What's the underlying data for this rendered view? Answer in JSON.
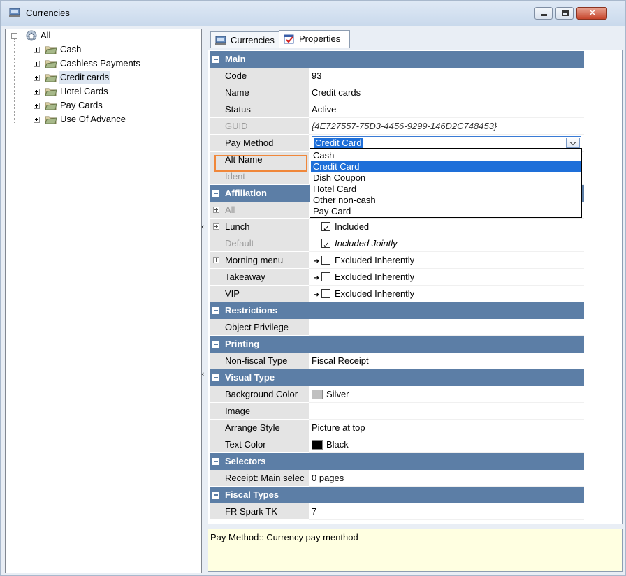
{
  "window": {
    "title": "Currencies"
  },
  "tree": {
    "root": "All",
    "items": [
      {
        "label": "Cash"
      },
      {
        "label": "Cashless Payments"
      },
      {
        "label": "Credit cards",
        "selected": true
      },
      {
        "label": "Hotel Cards"
      },
      {
        "label": "Pay Cards"
      },
      {
        "label": "Use Of Advance"
      }
    ]
  },
  "tabs": [
    {
      "label": "Currencies",
      "active": false
    },
    {
      "label": "Properties",
      "active": true
    }
  ],
  "properties": {
    "main": {
      "category": "Main",
      "code": {
        "name": "Code",
        "value": "93"
      },
      "name": {
        "name": "Name",
        "value": "Credit cards"
      },
      "status": {
        "name": "Status",
        "value": "Active"
      },
      "guid": {
        "name": "GUID",
        "value": "{4E727557-75D3-4456-9299-146D2C748453}"
      },
      "pay_method": {
        "name": "Pay Method",
        "value": "Credit Card"
      },
      "alt_name": {
        "name": "Alt Name"
      },
      "ident": {
        "name": "Ident"
      }
    },
    "affiliation": {
      "category": "Affiliation",
      "all": {
        "name": "All"
      },
      "lunch": {
        "name": "Lunch",
        "value": "Included"
      },
      "default": {
        "name": "Default",
        "value": "Included Jointly"
      },
      "morning_menu": {
        "name": "Morning menu",
        "value": "Excluded Inherently"
      },
      "takeaway": {
        "name": "Takeaway",
        "value": "Excluded Inherently"
      },
      "vip": {
        "name": "VIP",
        "value": "Excluded Inherently"
      }
    },
    "restrictions": {
      "category": "Restrictions",
      "object_privilege": {
        "name": "Object Privilege",
        "value": ""
      }
    },
    "printing": {
      "category": "Printing",
      "non_fiscal_type": {
        "name": "Non-fiscal Type",
        "value": "Fiscal Receipt"
      }
    },
    "visual_type": {
      "category": "Visual Type",
      "background_color": {
        "name": "Background Color",
        "value": "Silver",
        "swatch": "#c0c0c0"
      },
      "image": {
        "name": "Image",
        "value": ""
      },
      "arrange_style": {
        "name": "Arrange Style",
        "value": "Picture at top"
      },
      "text_color": {
        "name": "Text Color",
        "value": "Black",
        "swatch": "#000000"
      }
    },
    "selectors": {
      "category": "Selectors",
      "receipt_main": {
        "name": "Receipt: Main selec",
        "value": "0 pages"
      }
    },
    "fiscal_types": {
      "category": "Fiscal Types",
      "fr_spark_tk": {
        "name": "FR Spark TK",
        "value": "7"
      }
    }
  },
  "pay_method_dropdown": {
    "options": [
      "Cash",
      "Credit Card",
      "Dish Coupon",
      "Hotel Card",
      "Other non-cash",
      "Pay Card"
    ],
    "selected": "Credit Card"
  },
  "description": "Pay Method:: Currency pay menthod",
  "colors": {
    "category_header": "#5c7ea6",
    "selection": "#1e6fd9",
    "highlight_box": "#f0873a",
    "description_bg": "#ffffe1"
  }
}
